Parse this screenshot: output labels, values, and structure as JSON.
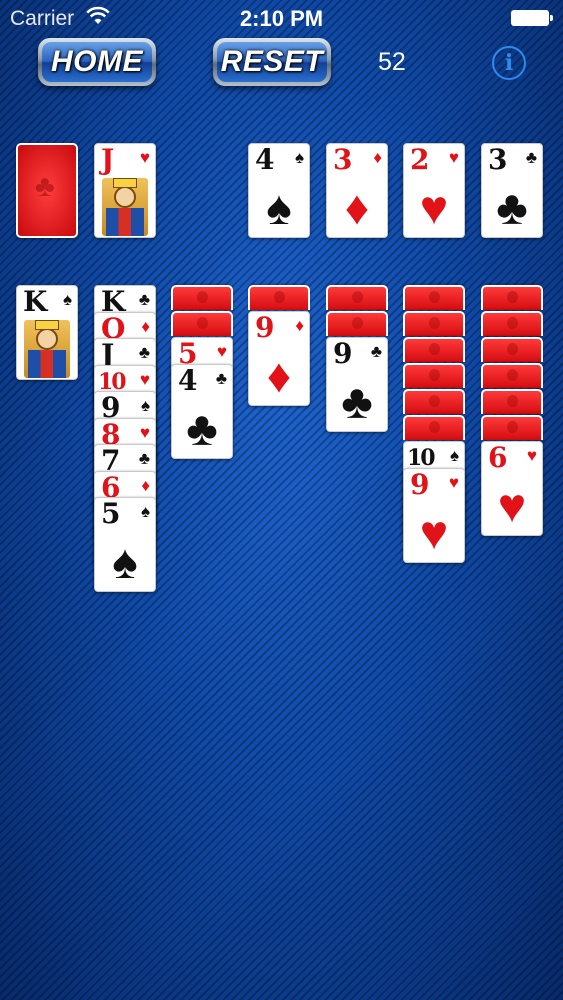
{
  "status_bar": {
    "carrier": "Carrier",
    "time": "2:10 PM"
  },
  "toolbar": {
    "home_label": "HOME",
    "reset_label": "RESET",
    "score": "52",
    "info_label": "i"
  },
  "colors": {
    "red_suit": "#e21318",
    "black_suit": "#111111",
    "felt": "#0b3f9a"
  },
  "game": {
    "waste": {
      "rank": "J",
      "suit": "♥",
      "color": "red"
    },
    "foundations": [
      {
        "rank": "4",
        "suit": "♠",
        "color": "black"
      },
      {
        "rank": "3",
        "suit": "♦",
        "color": "red"
      },
      {
        "rank": "2",
        "suit": "♥",
        "color": "red"
      },
      {
        "rank": "3",
        "suit": "♣",
        "color": "black"
      }
    ],
    "tableau": [
      {
        "face_down": 0,
        "face_up": [
          {
            "rank": "K",
            "suit": "♠",
            "color": "black"
          }
        ]
      },
      {
        "face_down": 0,
        "face_up": [
          {
            "rank": "K",
            "suit": "♣",
            "color": "black"
          },
          {
            "rank": "Q",
            "suit": "♦",
            "color": "red"
          },
          {
            "rank": "J",
            "suit": "♣",
            "color": "black"
          },
          {
            "rank": "10",
            "suit": "♥",
            "color": "red"
          },
          {
            "rank": "9",
            "suit": "♠",
            "color": "black"
          },
          {
            "rank": "8",
            "suit": "♥",
            "color": "red"
          },
          {
            "rank": "7",
            "suit": "♣",
            "color": "black"
          },
          {
            "rank": "6",
            "suit": "♦",
            "color": "red"
          },
          {
            "rank": "5",
            "suit": "♠",
            "color": "black"
          }
        ]
      },
      {
        "face_down": 2,
        "face_up": [
          {
            "rank": "5",
            "suit": "♥",
            "color": "red"
          },
          {
            "rank": "4",
            "suit": "♣",
            "color": "black"
          }
        ]
      },
      {
        "face_down": 1,
        "face_up": [
          {
            "rank": "9",
            "suit": "♦",
            "color": "red"
          }
        ]
      },
      {
        "face_down": 2,
        "face_up": [
          {
            "rank": "9",
            "suit": "♣",
            "color": "black"
          }
        ]
      },
      {
        "face_down": 6,
        "face_up": [
          {
            "rank": "10",
            "suit": "♠",
            "color": "black"
          },
          {
            "rank": "9",
            "suit": "♥",
            "color": "red"
          }
        ]
      },
      {
        "face_down": 6,
        "face_up": [
          {
            "rank": "6",
            "suit": "♥",
            "color": "red"
          }
        ]
      }
    ]
  }
}
